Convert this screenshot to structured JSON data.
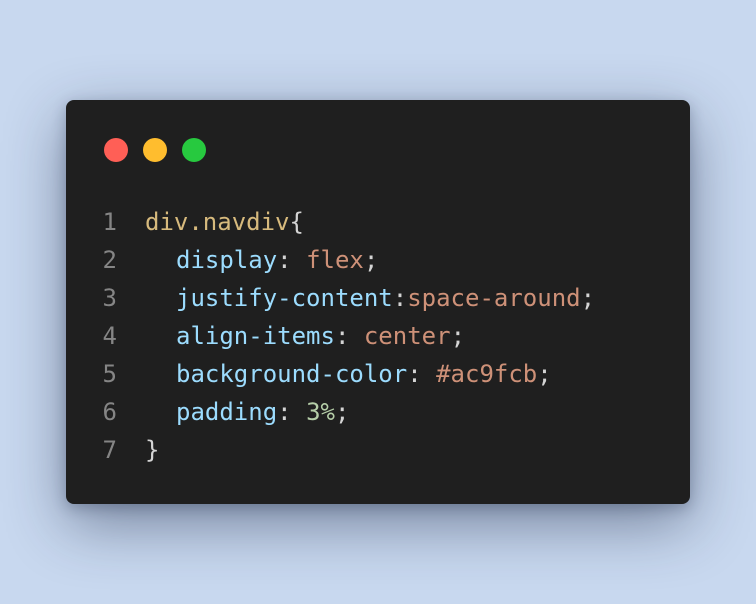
{
  "window": {
    "buttons": [
      "close",
      "minimize",
      "maximize"
    ]
  },
  "code": {
    "lines": [
      {
        "num": "1",
        "selector": "div.navdiv",
        "open": "{"
      },
      {
        "num": "2",
        "prop": "display",
        "sep": ": ",
        "value": "flex",
        "end": ";"
      },
      {
        "num": "3",
        "prop": "justify-content",
        "sep": ":",
        "value": "space-around",
        "end": ";"
      },
      {
        "num": "4",
        "prop": "align-items",
        "sep": ": ",
        "value": "center",
        "end": ";"
      },
      {
        "num": "5",
        "prop": "background-color",
        "sep": ": ",
        "value": "#ac9fcb",
        "end": ";"
      },
      {
        "num": "6",
        "prop": "padding",
        "sep": ": ",
        "value": "3%",
        "end": ";"
      },
      {
        "num": "7",
        "close": "}"
      }
    ]
  },
  "colors": {
    "background": "#c8d8ef",
    "editor_bg": "#1f1f1f",
    "selector": "#d7ba7d",
    "property": "#9cdcfe",
    "value_string": "#ce9178",
    "value_number": "#b5cea8",
    "line_number": "#858585"
  }
}
